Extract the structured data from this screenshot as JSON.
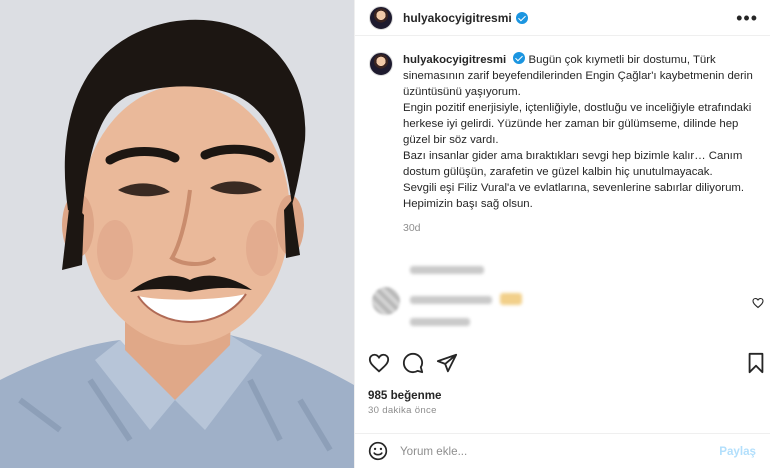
{
  "post": {
    "username": "hulyakocyigitresmi",
    "verified": true,
    "more_icon": "more-horizontal-icon"
  },
  "caption": {
    "username": "hulyakocyigitresmi",
    "line1": "Bugün çok kıymetli bir dostumu, Türk sinemasının zarif beyefendilerinden Engin Çağlar'ı kaybetmenin derin üzüntüsünü yaşıyorum.",
    "line2": "Engin pozitif enerjisiyle, içtenliğiyle, dostluğu ve inceliğiyle etrafındaki herkese iyi gelirdi. Yüzünde her zaman bir gülümseme, dilinde hep güzel bir söz vardı.",
    "line3": "Bazı insanlar gider ama bıraktıkları sevgi hep bizimle kalır… Canım dostum gülüşün, zarafetin ve güzel kalbin hiç unutulmayacak.",
    "line4": "Sevgili eşi Filiz Vural'a ve evlatlarına, sevenlerine sabırlar diliyorum. Hepimizin başı sağ olsun.",
    "time": "30d"
  },
  "actions": {
    "like_icon": "heart-icon",
    "comment_icon": "comment-icon",
    "share_icon": "share-icon",
    "save_icon": "bookmark-icon"
  },
  "likes": "985 beğenme",
  "posted_ago": "30 dakika önce",
  "comment_box": {
    "emoji_icon": "emoji-icon",
    "placeholder": "Yorum ekle...",
    "post_label": "Paylaş"
  },
  "colors": {
    "verified": "#1b95e0",
    "post_button": "#b2dffc",
    "muted_text": "#8e8e8e"
  }
}
